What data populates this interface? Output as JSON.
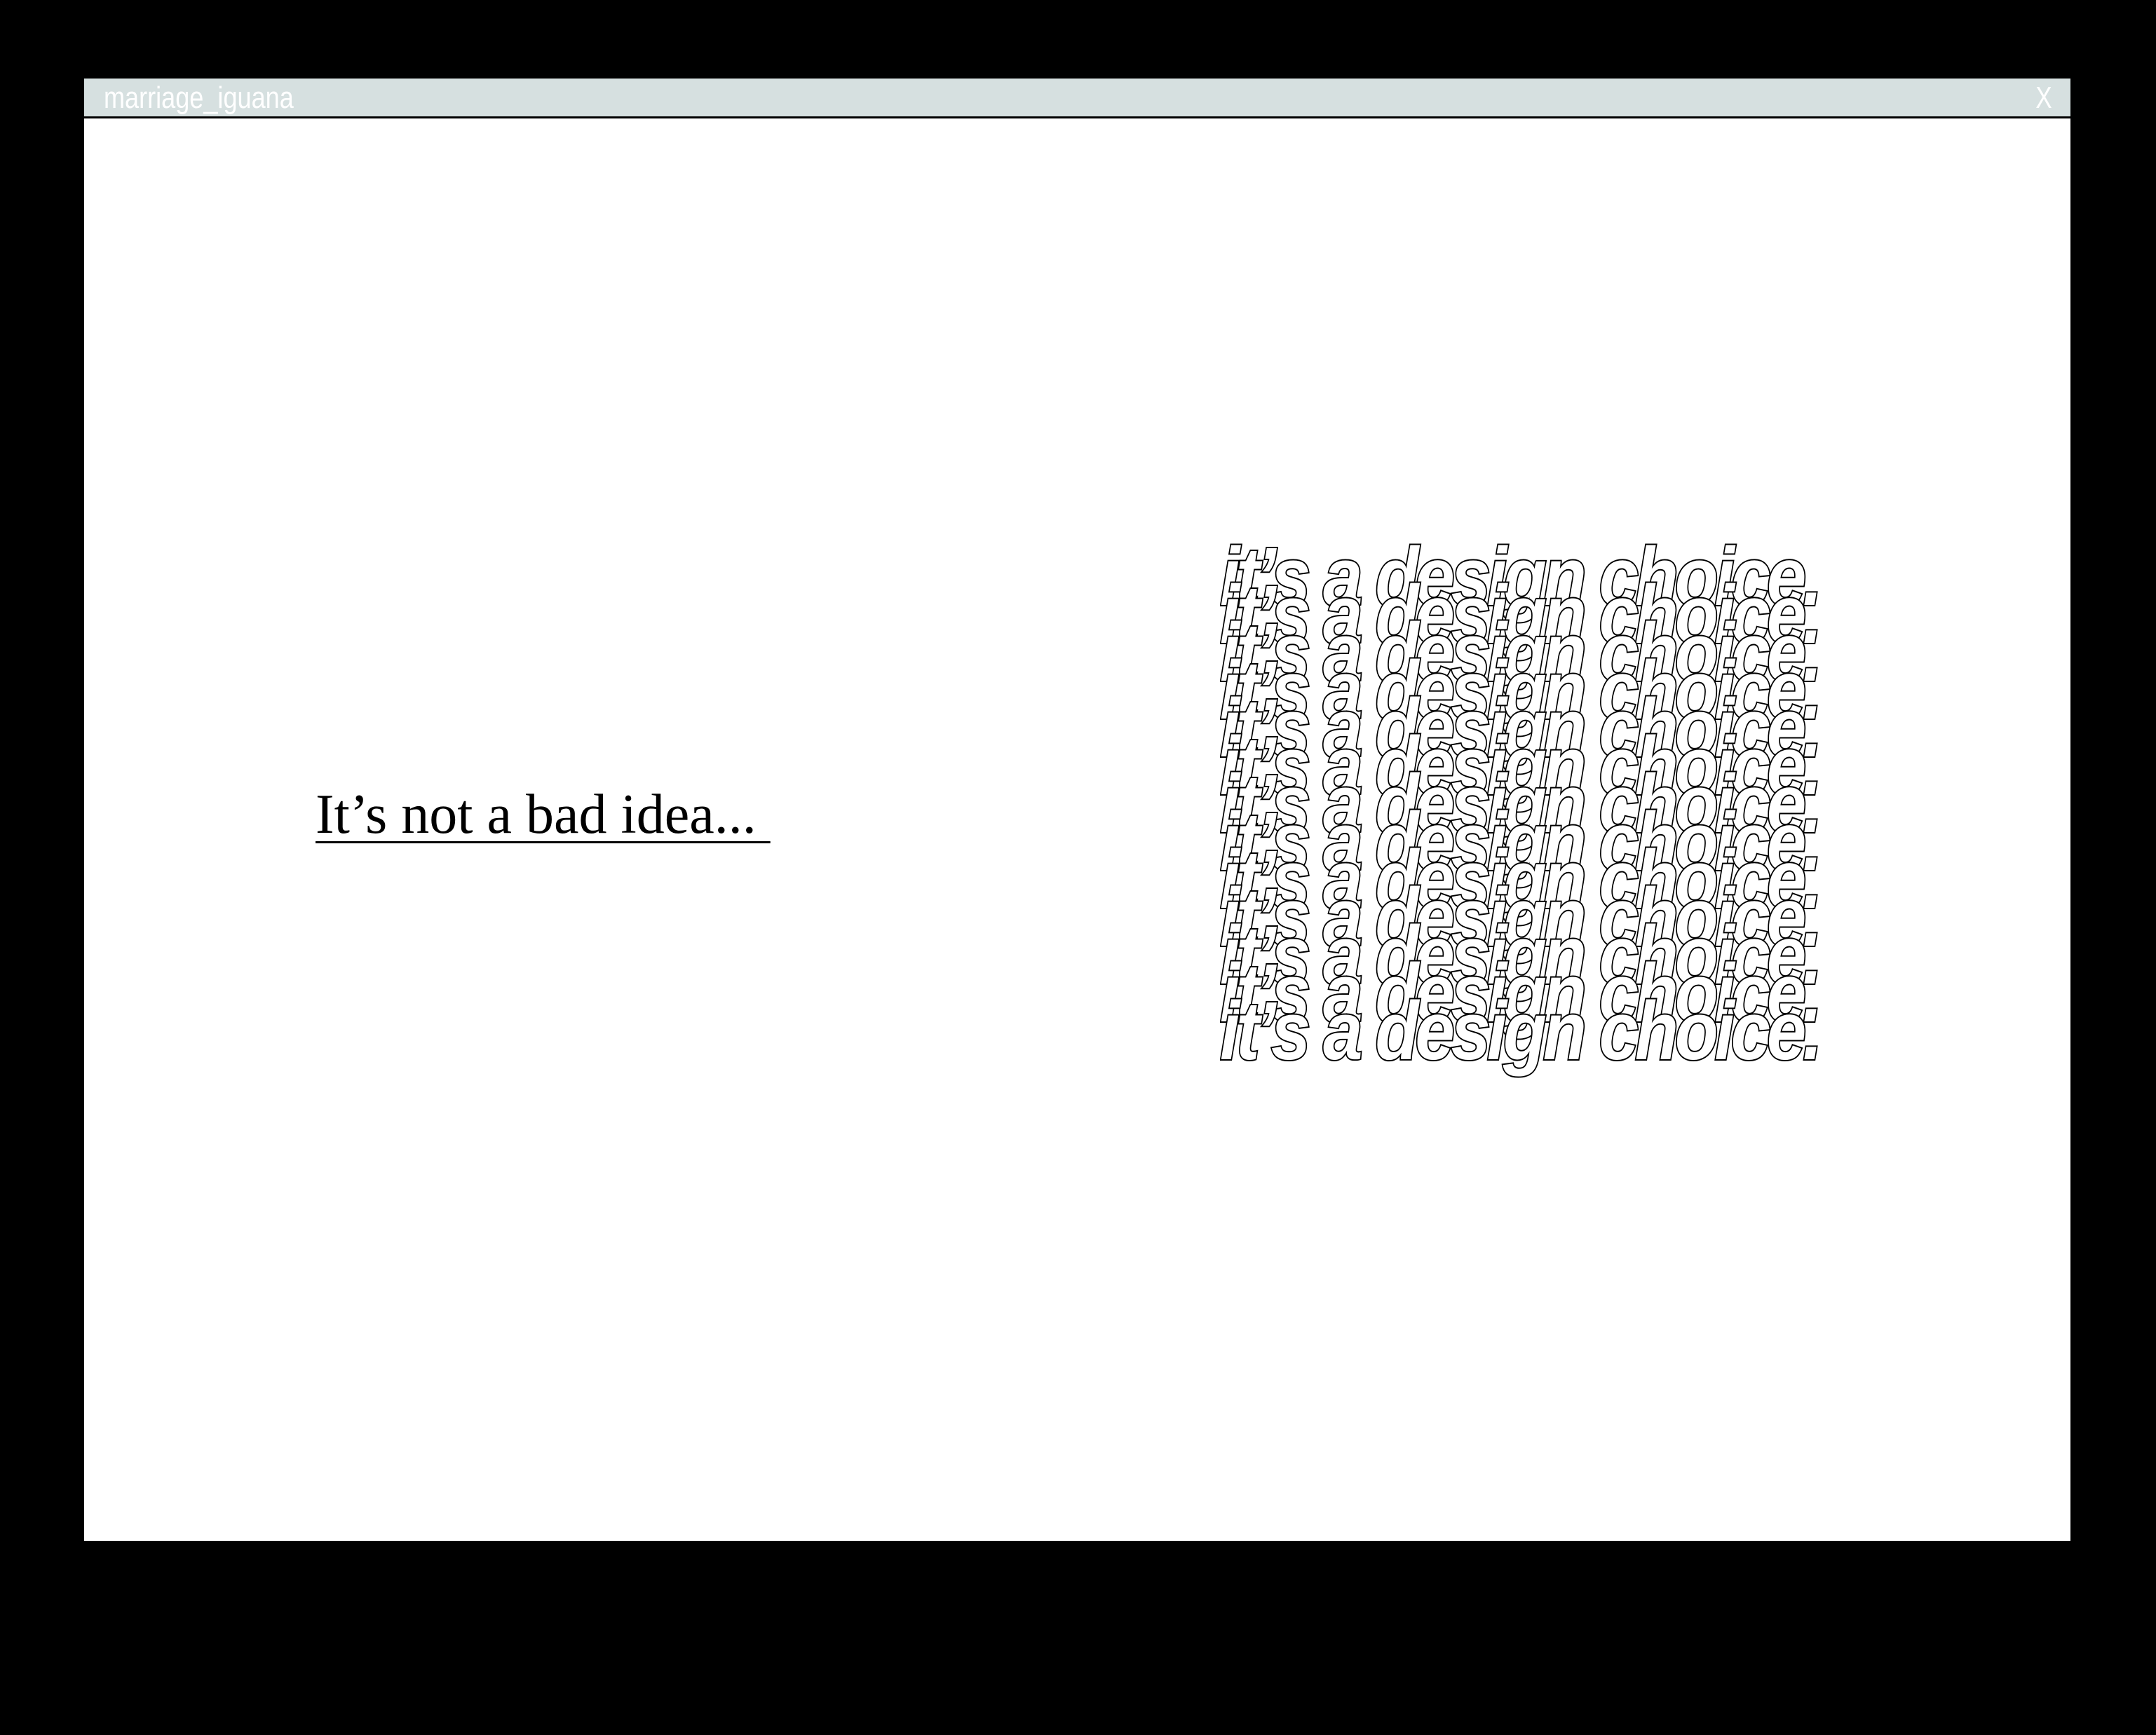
{
  "window": {
    "title": "marriage_iguana",
    "close_label": "X"
  },
  "content": {
    "left_text": "It’s not a bad idea... ",
    "stack_text": "it’s a design choice."
  },
  "colors": {
    "background": "#000000",
    "window": "#ffffff",
    "titlebar": "#d6e0e0",
    "titlebar_text": "#ffffff",
    "text": "#000000"
  }
}
